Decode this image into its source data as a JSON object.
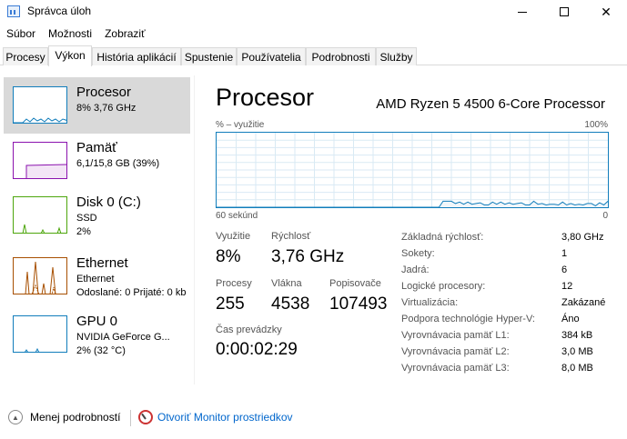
{
  "window": {
    "title": "Správca úloh",
    "icon": "task-manager-icon"
  },
  "menu": [
    "Súbor",
    "Možnosti",
    "Zobraziť"
  ],
  "tabs": [
    {
      "label": "Procesy",
      "active": false
    },
    {
      "label": "Výkon",
      "active": true
    },
    {
      "label": "História aplikácií",
      "active": false
    },
    {
      "label": "Spustenie",
      "active": false
    },
    {
      "label": "Používatelia",
      "active": false
    },
    {
      "label": "Podrobnosti",
      "active": false
    },
    {
      "label": "Služby",
      "active": false
    }
  ],
  "sidebar": [
    {
      "title": "Procesor",
      "line1": "8% 3,76 GHz",
      "line2": "",
      "color": "#117dbb",
      "selected": true
    },
    {
      "title": "Pamäť",
      "line1": "6,1/15,8 GB (39%)",
      "line2": "",
      "color": "#8b12ae",
      "selected": false
    },
    {
      "title": "Disk 0 (C:)",
      "line1": "SSD",
      "line2": "2%",
      "color": "#4da60c",
      "selected": false
    },
    {
      "title": "Ethernet",
      "line1": "Ethernet",
      "line2": "Odoslané: 0 Prijaté: 0 kb",
      "color": "#a74f01",
      "selected": false
    },
    {
      "title": "GPU 0",
      "line1": "NVIDIA GeForce G...",
      "line2": "2% (32 °C)",
      "color": "#117dbb",
      "selected": false
    }
  ],
  "main": {
    "title": "Procesor",
    "processor_name": "AMD Ryzen 5 4500 6-Core Processor",
    "graph_label_left": "% – využitie",
    "graph_label_right": "100%",
    "graph_time_label": "60 sekúnd",
    "graph_min_label": "0",
    "graph_color": "#117dbb",
    "cpu_usage_history_percent": [
      0,
      0,
      0,
      0,
      0,
      0,
      0,
      0,
      0,
      0,
      0,
      0,
      0,
      0,
      0,
      0,
      0,
      0,
      0,
      0,
      0,
      0,
      0,
      0,
      0,
      0,
      0,
      0,
      0,
      0,
      0,
      0,
      0,
      0,
      0,
      0,
      0,
      0,
      0,
      0,
      0,
      0,
      0,
      0,
      0,
      0,
      0,
      0,
      0,
      0,
      0,
      0,
      0,
      0,
      0,
      8,
      8,
      8,
      5,
      7,
      4,
      7,
      4,
      5,
      6,
      3,
      3,
      7,
      4,
      7,
      4,
      6,
      4,
      5,
      6,
      3,
      3,
      8,
      4,
      5,
      3,
      4,
      4,
      3,
      7,
      3,
      5,
      3,
      4,
      3,
      5,
      5,
      2,
      6,
      3,
      8
    ]
  },
  "stats": {
    "utilization_label": "Využitie",
    "utilization_value": "8%",
    "speed_label": "Rýchlosť",
    "speed_value": "3,76 GHz",
    "processes_label": "Procesy",
    "processes_value": "255",
    "threads_label": "Vlákna",
    "threads_value": "4538",
    "handles_label": "Popisovače",
    "handles_value": "107493",
    "uptime_label": "Čas prevádzky",
    "uptime_value": "0:00:02:29"
  },
  "specs": [
    {
      "label": "Základná rýchlosť:",
      "value": "3,80 GHz"
    },
    {
      "label": "Sokety:",
      "value": "1"
    },
    {
      "label": "Jadrá:",
      "value": "6"
    },
    {
      "label": "Logické procesory:",
      "value": "12"
    },
    {
      "label": "Virtualizácia:",
      "value": "Zakázané"
    },
    {
      "label": "Podpora technológie Hyper-V:",
      "value": "Áno"
    },
    {
      "label": "Vyrovnávacia pamäť L1:",
      "value": "384 kB"
    },
    {
      "label": "Vyrovnávacia pamäť L2:",
      "value": "3,0 MB"
    },
    {
      "label": "Vyrovnávacia pamäť L3:",
      "value": "8,0 MB"
    }
  ],
  "footer": {
    "less_details": "Menej podrobností",
    "open_monitor": "Otvoriť Monitor prostriedkov"
  }
}
